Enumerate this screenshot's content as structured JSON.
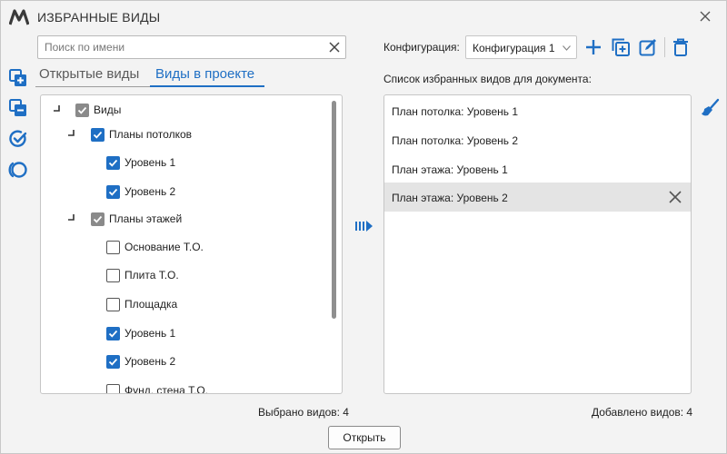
{
  "window": {
    "title": "ИЗБРАННЫЕ ВИДЫ"
  },
  "search": {
    "placeholder": "Поиск по имени",
    "value": ""
  },
  "tabs": [
    {
      "label": "Открытые виды",
      "active": false
    },
    {
      "label": "Виды в проекте",
      "active": true
    }
  ],
  "tree": [
    {
      "label": "Виды",
      "level": 0,
      "state": "indeterminate",
      "expanded": true
    },
    {
      "label": "Планы потолков",
      "level": 1,
      "state": "checked",
      "expanded": true
    },
    {
      "label": "Уровень 1",
      "level": 2,
      "state": "checked"
    },
    {
      "label": "Уровень 2",
      "level": 2,
      "state": "checked"
    },
    {
      "label": "Планы этажей",
      "level": 1,
      "state": "indeterminate",
      "expanded": true
    },
    {
      "label": "Основание Т.О.",
      "level": 2,
      "state": "unchecked"
    },
    {
      "label": "Плита Т.О.",
      "level": 2,
      "state": "unchecked"
    },
    {
      "label": "Площадка",
      "level": 2,
      "state": "unchecked"
    },
    {
      "label": "Уровень 1",
      "level": 2,
      "state": "checked"
    },
    {
      "label": "Уровень 2",
      "level": 2,
      "state": "checked"
    },
    {
      "label": "Фунд. стена Т.О.",
      "level": 2,
      "state": "unchecked"
    }
  ],
  "config": {
    "label": "Конфигурация:",
    "selected": "Конфигурация 1"
  },
  "favorites": {
    "title": "Список избранных видов для документа:",
    "items": [
      {
        "label": "План потолка: Уровень 1",
        "selected": false
      },
      {
        "label": "План потолка: Уровень 2",
        "selected": false
      },
      {
        "label": "План этажа: Уровень 1",
        "selected": false
      },
      {
        "label": "План этажа: Уровень 2",
        "selected": true
      }
    ]
  },
  "counts": {
    "selected": "Выбрано видов: 4",
    "added": "Добавлено видов: 4"
  },
  "buttons": {
    "open": "Открыть"
  },
  "colors": {
    "accent": "#1f6fc4",
    "indeterminate": "#8a8a8a",
    "selected_row": "#e4e4e4"
  },
  "icons": [
    "app-logo-icon",
    "close-icon",
    "clear-search-icon",
    "add-views-icon",
    "remove-views-icon",
    "check-all-icon",
    "uncheck-all-icon",
    "add-to-list-arrow-icon",
    "plus-icon",
    "add-config-icon",
    "edit-icon",
    "delete-icon",
    "broom-icon",
    "remove-item-icon"
  ]
}
